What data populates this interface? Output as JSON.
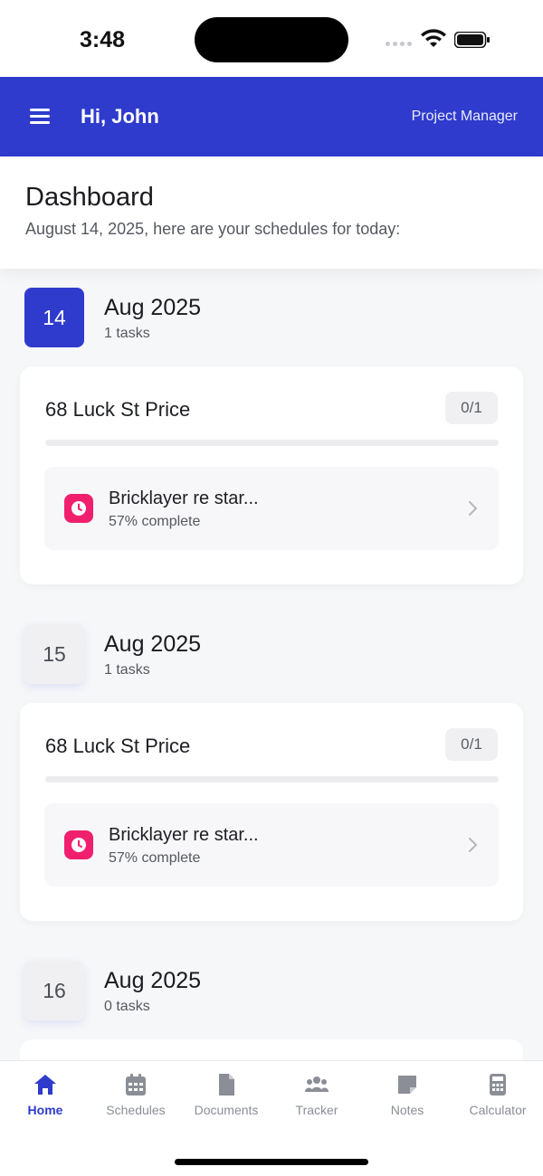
{
  "status_bar": {
    "time": "3:48"
  },
  "header": {
    "greeting": "Hi, John",
    "role": "Project Manager"
  },
  "dashboard": {
    "title": "Dashboard",
    "subtitle": "August 14, 2025, here are your schedules for today:"
  },
  "days": [
    {
      "day": "14",
      "month": "Aug 2025",
      "count": "1 tasks",
      "selected": true,
      "card": {
        "title": "68 Luck St Price",
        "badge": "0/1",
        "progress": 0,
        "task": {
          "name": "Bricklayer re star...",
          "complete": "57% complete",
          "icon": "clock-icon"
        }
      }
    },
    {
      "day": "15",
      "month": "Aug 2025",
      "count": "1 tasks",
      "selected": false,
      "card": {
        "title": "68 Luck St Price",
        "badge": "0/1",
        "progress": 0,
        "task": {
          "name": "Bricklayer re star...",
          "complete": "57% complete",
          "icon": "clock-icon"
        }
      }
    },
    {
      "day": "16",
      "month": "Aug 2025",
      "count": "0 tasks",
      "selected": false
    }
  ],
  "nav": [
    {
      "label": "Home",
      "icon": "home-icon",
      "active": true
    },
    {
      "label": "Schedules",
      "icon": "calendar-icon",
      "active": false
    },
    {
      "label": "Documents",
      "icon": "document-icon",
      "active": false
    },
    {
      "label": "Tracker",
      "icon": "people-icon",
      "active": false
    },
    {
      "label": "Notes",
      "icon": "note-icon",
      "active": false
    },
    {
      "label": "Calculator",
      "icon": "calculator-icon",
      "active": false
    }
  ],
  "colors": {
    "primary": "#2f3bcc",
    "task_icon": "#f0206f",
    "inactive_nav": "#8b8e96"
  }
}
